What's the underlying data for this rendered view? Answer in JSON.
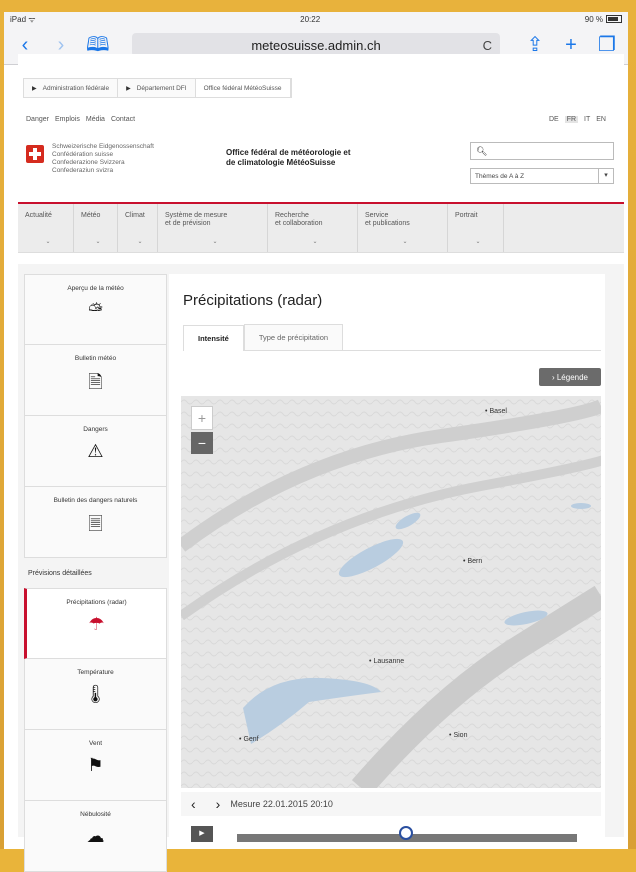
{
  "status": {
    "device": "iPad ᯤ",
    "time": "20:22",
    "battery": "90 %"
  },
  "browser": {
    "url": "meteosuisse.admin.ch",
    "reload": "C"
  },
  "breadcrumb": [
    "Administration fédérale",
    "Département DFI",
    "Office fédéral MétéoSuisse"
  ],
  "topnav": [
    "Danger",
    "Emplois",
    "Média",
    "Contact"
  ],
  "languages": [
    "DE",
    "FR",
    "IT",
    "EN"
  ],
  "selected_language": "FR",
  "confederation": [
    "Schweizerische Eidgenossenschaft",
    "Confédération suisse",
    "Confederazione Svizzera",
    "Confederaziun svizra"
  ],
  "office": [
    "Office fédéral de météorologie et",
    "de climatologie MétéoSuisse"
  ],
  "search": {
    "icon": "search-icon"
  },
  "themes": {
    "label": "Thèmes de A à Z"
  },
  "mainnav": [
    {
      "label1": "Actualité",
      "label2": ""
    },
    {
      "label1": "Météo",
      "label2": ""
    },
    {
      "label1": "Climat",
      "label2": ""
    },
    {
      "label1": "Système de mesure",
      "label2": "et de prévision"
    },
    {
      "label1": "Recherche",
      "label2": "et collaboration"
    },
    {
      "label1": "Service",
      "label2": "et publications"
    },
    {
      "label1": "Portrait",
      "label2": ""
    }
  ],
  "sidebar": {
    "tiles_top": [
      {
        "label": "Aperçu de la météo",
        "icon": "sun-cloud-icon"
      },
      {
        "label": "Bulletin météo",
        "icon": "bulletin-icon"
      },
      {
        "label": "Dangers",
        "icon": "warning-icon"
      },
      {
        "label": "Bulletin des dangers naturels",
        "icon": "natural-hazards-icon"
      }
    ],
    "heading": "Prévisions détaillées",
    "tiles_bottom": [
      {
        "label": "Précipitations (radar)",
        "icon": "umbrella-icon"
      },
      {
        "label": "Température",
        "icon": "thermometer-icon"
      },
      {
        "label": "Vent",
        "icon": "windsock-icon"
      },
      {
        "label": "Nébulosité",
        "icon": "cloud-icon"
      }
    ]
  },
  "main": {
    "title": "Précipitations (radar)",
    "tabs": [
      "Intensité",
      "Type de précipitation"
    ],
    "legend_button": "Légende",
    "zoom_plus": "+",
    "zoom_minus": "−",
    "cities": [
      "Basel",
      "Bern",
      "Lausanne",
      "Genf",
      "Sion"
    ],
    "timeline_label": "Mesure 22.01.2015 20:10"
  },
  "colors": {
    "accent_red": "#c8102e",
    "link_blue": "#1b77e8"
  }
}
